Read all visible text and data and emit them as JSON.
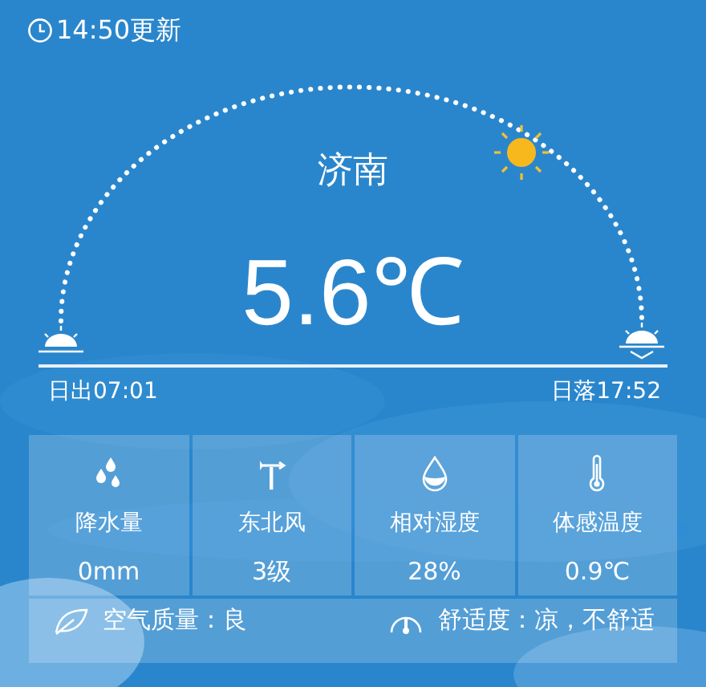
{
  "update_time": "14:50更新",
  "city": "济南",
  "temperature": "5.6℃",
  "sunrise": "日出07:01",
  "sunset": "日落17:52",
  "details": [
    {
      "kind": "rain",
      "label": "降水量",
      "value": "0mm"
    },
    {
      "kind": "wind",
      "label": "东北风",
      "value": "3级"
    },
    {
      "kind": "humidity",
      "label": "相对湿度",
      "value": "28%"
    },
    {
      "kind": "feels",
      "label": "体感温度",
      "value": "0.9℃"
    }
  ],
  "air_quality": "空气质量：良",
  "comfort": "舒适度：凉，不舒适"
}
